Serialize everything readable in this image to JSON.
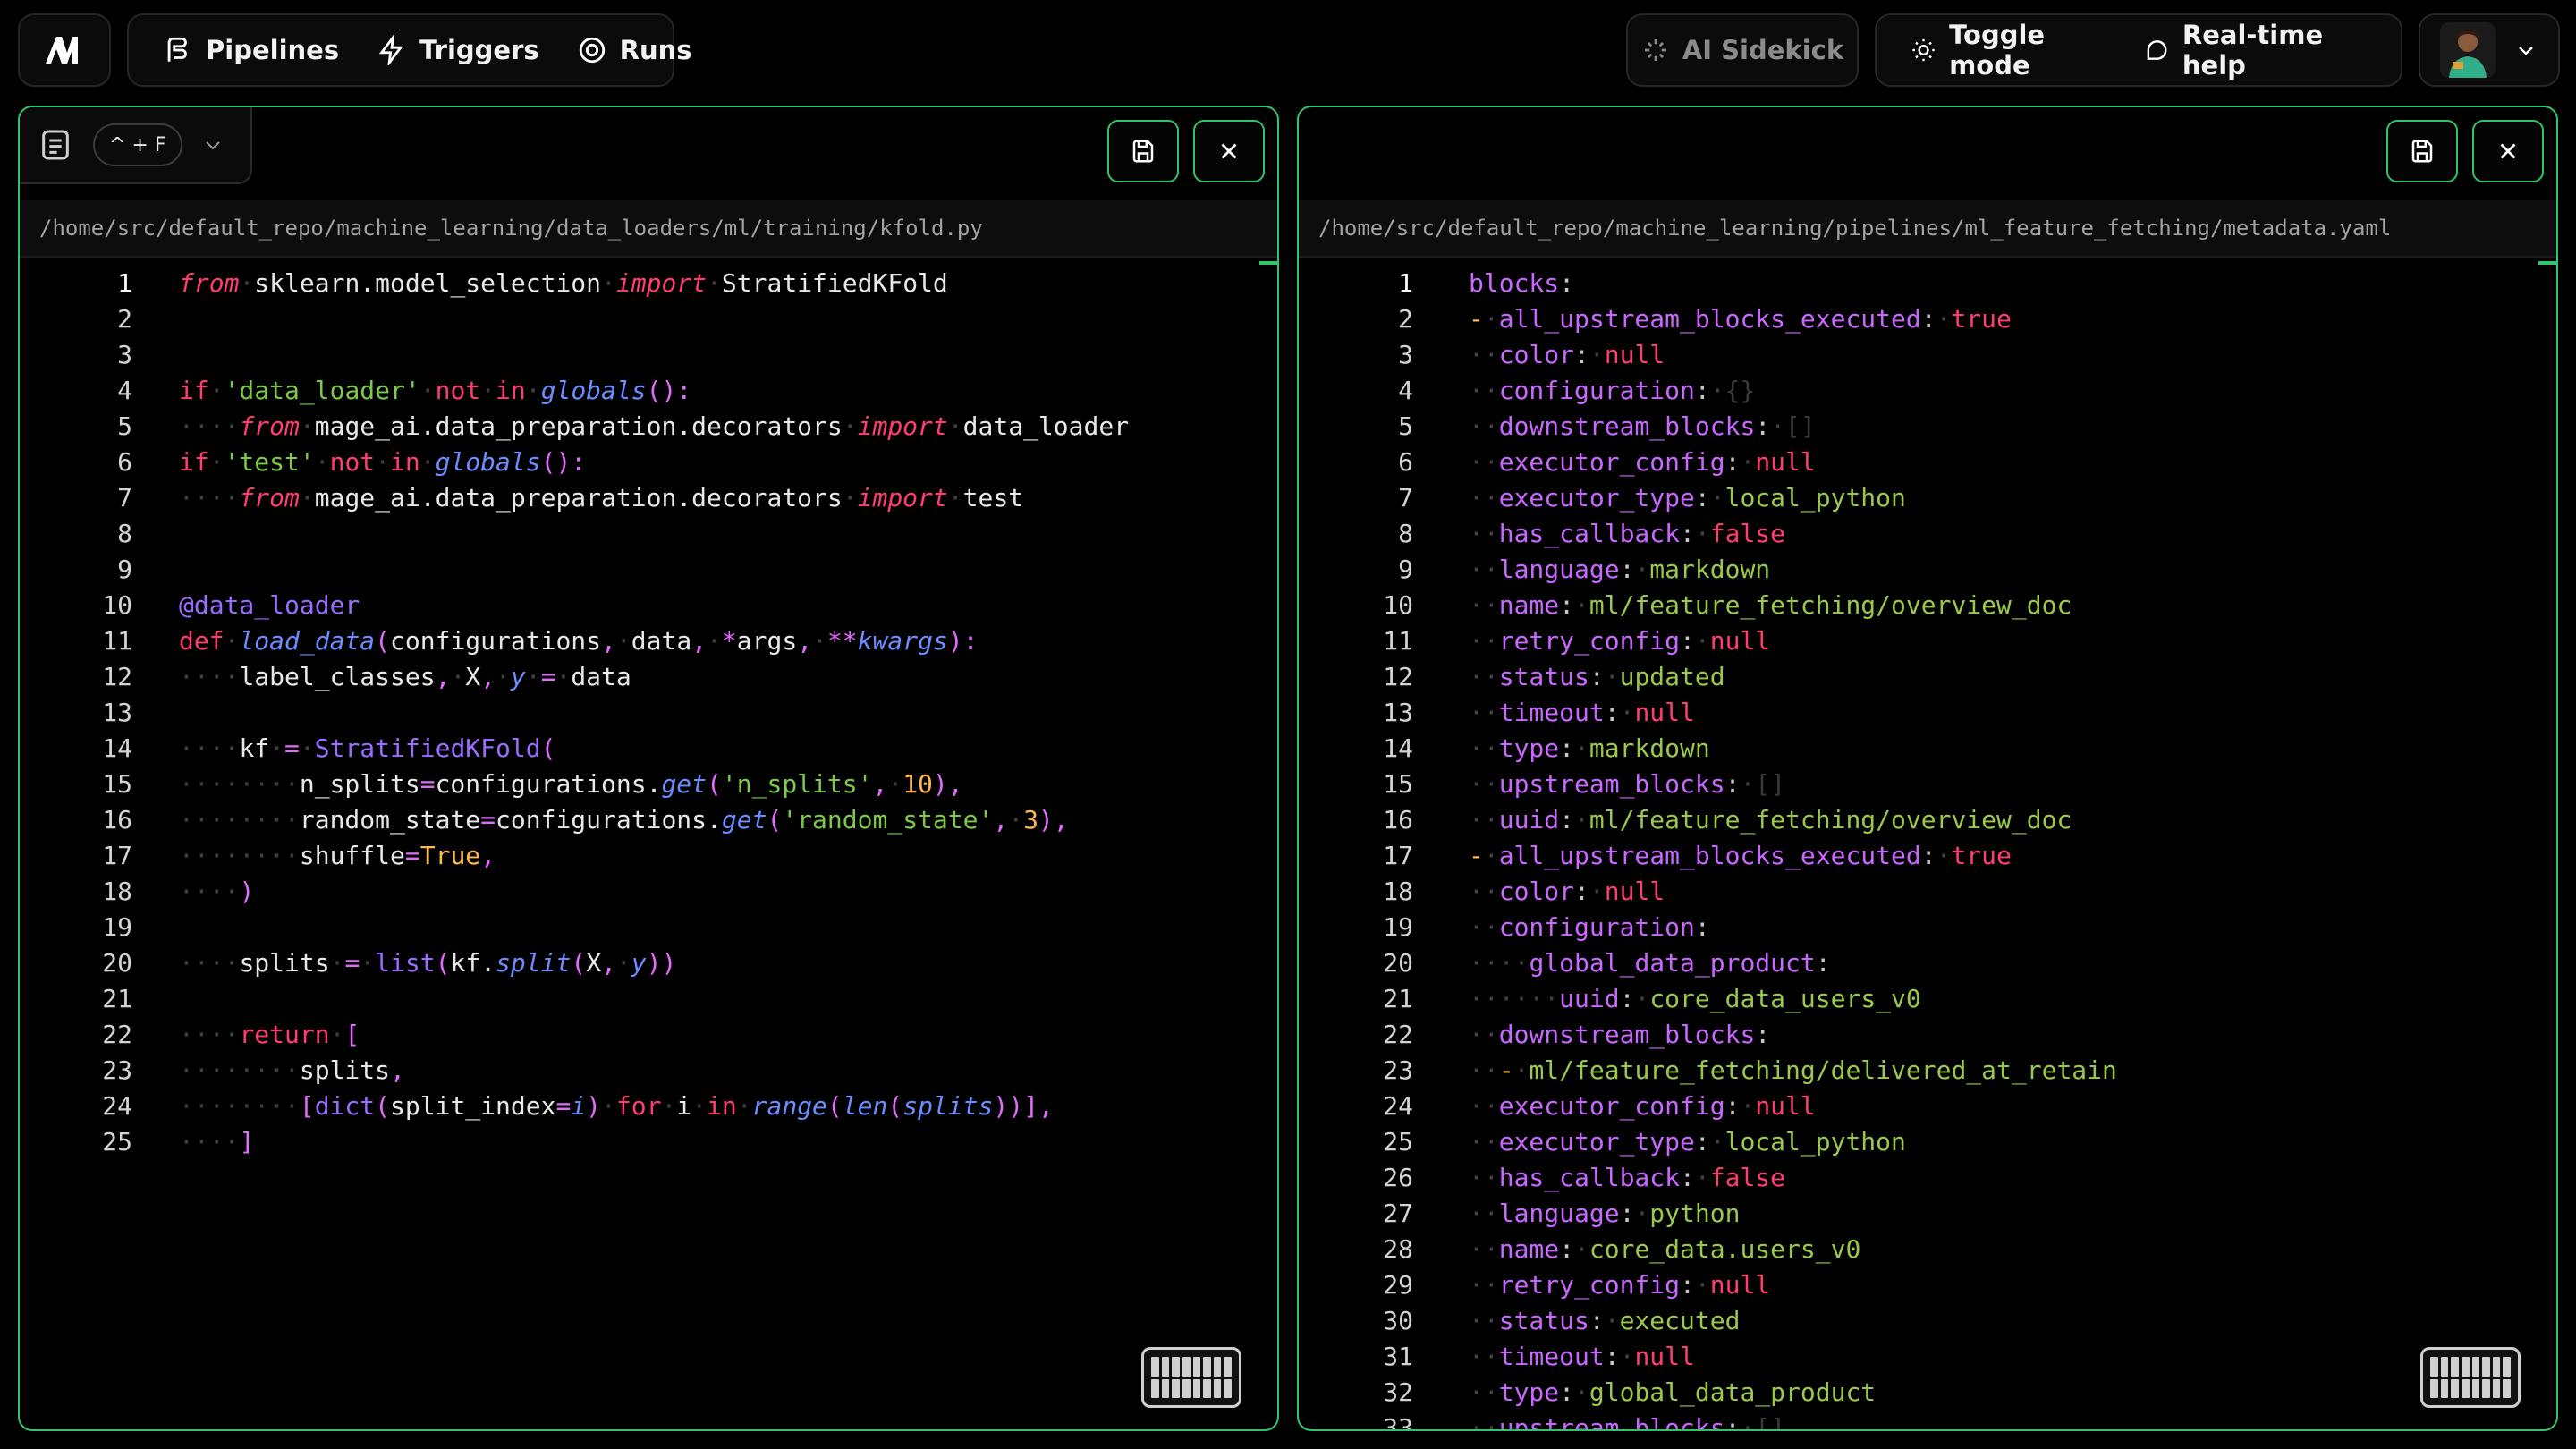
{
  "nav": {
    "pipelines": "Pipelines",
    "triggers": "Triggers",
    "runs": "Runs"
  },
  "actions": {
    "ai_sidekick": "AI Sidekick",
    "toggle_mode": "Toggle mode",
    "realtime_help": "Real-time help"
  },
  "left_panel": {
    "shortcut": "^ + F",
    "path": "/home/src/default_repo/machine_learning/data_loaders/ml/training/kfold.py"
  },
  "right_panel": {
    "path": "/home/src/default_repo/machine_learning/pipelines/ml_feature_fetching/metadata.yaml"
  },
  "colors": {
    "accent": "#30c46b",
    "keyword": "#ff3d6e",
    "function": "#6c8cff",
    "string": "#7cc84a",
    "number": "#ffb84d",
    "yaml_key": "#c968ff"
  },
  "left_code": [
    [
      [
        "kwi",
        "from"
      ],
      [
        "ws",
        "·"
      ],
      [
        "tx",
        "sklearn.model_selection"
      ],
      [
        "ws",
        "·"
      ],
      [
        "kwi",
        "import"
      ],
      [
        "ws",
        "·"
      ],
      [
        "tx",
        "StratifiedKFold"
      ]
    ],
    [],
    [],
    [
      [
        "kw",
        "if"
      ],
      [
        "ws",
        "·"
      ],
      [
        "str",
        "'data_loader'"
      ],
      [
        "ws",
        "·"
      ],
      [
        "kw",
        "not"
      ],
      [
        "ws",
        "·"
      ],
      [
        "kw",
        "in"
      ],
      [
        "ws",
        "·"
      ],
      [
        "fn",
        "globals"
      ],
      [
        "par",
        "():"
      ]
    ],
    [
      [
        "ws",
        "····"
      ],
      [
        "kwi",
        "from"
      ],
      [
        "ws",
        "·"
      ],
      [
        "tx",
        "mage_ai.data_preparation.decorators"
      ],
      [
        "ws",
        "·"
      ],
      [
        "kwi",
        "import"
      ],
      [
        "ws",
        "·"
      ],
      [
        "tx",
        "data_loader"
      ]
    ],
    [
      [
        "kw",
        "if"
      ],
      [
        "ws",
        "·"
      ],
      [
        "str",
        "'test'"
      ],
      [
        "ws",
        "·"
      ],
      [
        "kw",
        "not"
      ],
      [
        "ws",
        "·"
      ],
      [
        "kw",
        "in"
      ],
      [
        "ws",
        "·"
      ],
      [
        "fn",
        "globals"
      ],
      [
        "par",
        "():"
      ]
    ],
    [
      [
        "ws",
        "····"
      ],
      [
        "kwi",
        "from"
      ],
      [
        "ws",
        "·"
      ],
      [
        "tx",
        "mage_ai.data_preparation.decorators"
      ],
      [
        "ws",
        "·"
      ],
      [
        "kwi",
        "import"
      ],
      [
        "ws",
        "·"
      ],
      [
        "tx",
        "test"
      ]
    ],
    [],
    [],
    [
      [
        "dec",
        "@data_loader"
      ]
    ],
    [
      [
        "kw",
        "def"
      ],
      [
        "ws",
        "·"
      ],
      [
        "fn",
        "load_data"
      ],
      [
        "par",
        "("
      ],
      [
        "tx",
        "configurations"
      ],
      [
        "pun",
        ","
      ],
      [
        "ws",
        "·"
      ],
      [
        "tx",
        "data"
      ],
      [
        "pun",
        ","
      ],
      [
        "ws",
        "·"
      ],
      [
        "pun",
        "*"
      ],
      [
        "tx",
        "args"
      ],
      [
        "pun",
        ","
      ],
      [
        "ws",
        "·"
      ],
      [
        "pun",
        "**"
      ],
      [
        "fn",
        "kwargs"
      ],
      [
        "par",
        "):"
      ]
    ],
    [
      [
        "ws",
        "····"
      ],
      [
        "tx",
        "label_classes"
      ],
      [
        "pun",
        ","
      ],
      [
        "ws",
        "·"
      ],
      [
        "tx",
        "X"
      ],
      [
        "pun",
        ","
      ],
      [
        "ws",
        "·"
      ],
      [
        "fn",
        "y"
      ],
      [
        "ws",
        "·"
      ],
      [
        "pun",
        "="
      ],
      [
        "ws",
        "·"
      ],
      [
        "tx",
        "data"
      ]
    ],
    [],
    [
      [
        "ws",
        "····"
      ],
      [
        "tx",
        "kf"
      ],
      [
        "ws",
        "·"
      ],
      [
        "pun",
        "="
      ],
      [
        "ws",
        "·"
      ],
      [
        "cls",
        "StratifiedKFold"
      ],
      [
        "par",
        "("
      ]
    ],
    [
      [
        "ws",
        "········"
      ],
      [
        "tx",
        "n_splits"
      ],
      [
        "pun",
        "="
      ],
      [
        "tx",
        "configurations."
      ],
      [
        "fn",
        "get"
      ],
      [
        "par",
        "("
      ],
      [
        "str",
        "'n_splits'"
      ],
      [
        "pun",
        ","
      ],
      [
        "ws",
        "·"
      ],
      [
        "num",
        "10"
      ],
      [
        "par",
        "),"
      ]
    ],
    [
      [
        "ws",
        "········"
      ],
      [
        "tx",
        "random_state"
      ],
      [
        "pun",
        "="
      ],
      [
        "tx",
        "configurations."
      ],
      [
        "fn",
        "get"
      ],
      [
        "par",
        "("
      ],
      [
        "str",
        "'random_state'"
      ],
      [
        "pun",
        ","
      ],
      [
        "ws",
        "·"
      ],
      [
        "num",
        "3"
      ],
      [
        "par",
        "),"
      ]
    ],
    [
      [
        "ws",
        "········"
      ],
      [
        "tx",
        "shuffle"
      ],
      [
        "pun",
        "="
      ],
      [
        "bool",
        "True"
      ],
      [
        "pun",
        ","
      ]
    ],
    [
      [
        "ws",
        "····"
      ],
      [
        "par",
        ")"
      ]
    ],
    [],
    [
      [
        "ws",
        "····"
      ],
      [
        "tx",
        "splits"
      ],
      [
        "ws",
        "·"
      ],
      [
        "pun",
        "="
      ],
      [
        "ws",
        "·"
      ],
      [
        "cls",
        "list"
      ],
      [
        "par",
        "("
      ],
      [
        "tx",
        "kf."
      ],
      [
        "fn",
        "split"
      ],
      [
        "par",
        "("
      ],
      [
        "tx",
        "X"
      ],
      [
        "pun",
        ","
      ],
      [
        "ws",
        "·"
      ],
      [
        "fn",
        "y"
      ],
      [
        "par",
        "))"
      ]
    ],
    [],
    [
      [
        "ws",
        "····"
      ],
      [
        "kw",
        "return"
      ],
      [
        "ws",
        "·"
      ],
      [
        "par",
        "["
      ]
    ],
    [
      [
        "ws",
        "········"
      ],
      [
        "tx",
        "splits"
      ],
      [
        "pun",
        ","
      ]
    ],
    [
      [
        "ws",
        "········"
      ],
      [
        "par",
        "["
      ],
      [
        "cls",
        "dict"
      ],
      [
        "par",
        "("
      ],
      [
        "tx",
        "split_index"
      ],
      [
        "pun",
        "="
      ],
      [
        "fn",
        "i"
      ],
      [
        "par",
        ")"
      ],
      [
        "ws",
        "·"
      ],
      [
        "kw",
        "for"
      ],
      [
        "ws",
        "·"
      ],
      [
        "tx",
        "i"
      ],
      [
        "ws",
        "·"
      ],
      [
        "kw",
        "in"
      ],
      [
        "ws",
        "·"
      ],
      [
        "fn",
        "range"
      ],
      [
        "par",
        "("
      ],
      [
        "fn",
        "len"
      ],
      [
        "par",
        "("
      ],
      [
        "fn",
        "splits"
      ],
      [
        "par",
        "))],"
      ]
    ],
    [
      [
        "ws",
        "····"
      ],
      [
        "par",
        "]"
      ]
    ]
  ],
  "right_code": [
    [
      [
        "ykey",
        "blocks"
      ],
      [
        "yplain",
        ":"
      ]
    ],
    [
      [
        "ydash",
        "-"
      ],
      [
        "ws",
        "·"
      ],
      [
        "ykey",
        "all_upstream_blocks_executed"
      ],
      [
        "yplain",
        ":"
      ],
      [
        "ws",
        "·"
      ],
      [
        "ynull",
        "true"
      ]
    ],
    [
      [
        "ws",
        "··"
      ],
      [
        "ykey",
        "color"
      ],
      [
        "yplain",
        ":"
      ],
      [
        "ws",
        "·"
      ],
      [
        "ynull",
        "null"
      ]
    ],
    [
      [
        "ws",
        "··"
      ],
      [
        "ykey",
        "configuration"
      ],
      [
        "yplain",
        ":"
      ],
      [
        "ws",
        "·"
      ],
      [
        "ydim",
        "{}"
      ]
    ],
    [
      [
        "ws",
        "··"
      ],
      [
        "ykey",
        "downstream_blocks"
      ],
      [
        "yplain",
        ":"
      ],
      [
        "ws",
        "·"
      ],
      [
        "ydim",
        "[]"
      ]
    ],
    [
      [
        "ws",
        "··"
      ],
      [
        "ykey",
        "executor_config"
      ],
      [
        "yplain",
        ":"
      ],
      [
        "ws",
        "·"
      ],
      [
        "ynull",
        "null"
      ]
    ],
    [
      [
        "ws",
        "··"
      ],
      [
        "ykey",
        "executor_type"
      ],
      [
        "yplain",
        ":"
      ],
      [
        "ws",
        "·"
      ],
      [
        "yval",
        "local_python"
      ]
    ],
    [
      [
        "ws",
        "··"
      ],
      [
        "ykey",
        "has_callback"
      ],
      [
        "yplain",
        ":"
      ],
      [
        "ws",
        "·"
      ],
      [
        "ynull",
        "false"
      ]
    ],
    [
      [
        "ws",
        "··"
      ],
      [
        "ykey",
        "language"
      ],
      [
        "yplain",
        ":"
      ],
      [
        "ws",
        "·"
      ],
      [
        "yval",
        "markdown"
      ]
    ],
    [
      [
        "ws",
        "··"
      ],
      [
        "ykey",
        "name"
      ],
      [
        "yplain",
        ":"
      ],
      [
        "ws",
        "·"
      ],
      [
        "yval",
        "ml/feature_fetching/overview_doc"
      ]
    ],
    [
      [
        "ws",
        "··"
      ],
      [
        "ykey",
        "retry_config"
      ],
      [
        "yplain",
        ":"
      ],
      [
        "ws",
        "·"
      ],
      [
        "ynull",
        "null"
      ]
    ],
    [
      [
        "ws",
        "··"
      ],
      [
        "ykey",
        "status"
      ],
      [
        "yplain",
        ":"
      ],
      [
        "ws",
        "·"
      ],
      [
        "yval",
        "updated"
      ]
    ],
    [
      [
        "ws",
        "··"
      ],
      [
        "ykey",
        "timeout"
      ],
      [
        "yplain",
        ":"
      ],
      [
        "ws",
        "·"
      ],
      [
        "ynull",
        "null"
      ]
    ],
    [
      [
        "ws",
        "··"
      ],
      [
        "ykey",
        "type"
      ],
      [
        "yplain",
        ":"
      ],
      [
        "ws",
        "·"
      ],
      [
        "yval",
        "markdown"
      ]
    ],
    [
      [
        "ws",
        "··"
      ],
      [
        "ykey",
        "upstream_blocks"
      ],
      [
        "yplain",
        ":"
      ],
      [
        "ws",
        "·"
      ],
      [
        "ydim",
        "[]"
      ]
    ],
    [
      [
        "ws",
        "··"
      ],
      [
        "ykey",
        "uuid"
      ],
      [
        "yplain",
        ":"
      ],
      [
        "ws",
        "·"
      ],
      [
        "yval",
        "ml/feature_fetching/overview_doc"
      ]
    ],
    [
      [
        "ydash",
        "-"
      ],
      [
        "ws",
        "·"
      ],
      [
        "ykey",
        "all_upstream_blocks_executed"
      ],
      [
        "yplain",
        ":"
      ],
      [
        "ws",
        "·"
      ],
      [
        "ynull",
        "true"
      ]
    ],
    [
      [
        "ws",
        "··"
      ],
      [
        "ykey",
        "color"
      ],
      [
        "yplain",
        ":"
      ],
      [
        "ws",
        "·"
      ],
      [
        "ynull",
        "null"
      ]
    ],
    [
      [
        "ws",
        "··"
      ],
      [
        "ykey",
        "configuration"
      ],
      [
        "yplain",
        ":"
      ]
    ],
    [
      [
        "ws",
        "····"
      ],
      [
        "ykey",
        "global_data_product"
      ],
      [
        "yplain",
        ":"
      ]
    ],
    [
      [
        "ws",
        "······"
      ],
      [
        "ykey",
        "uuid"
      ],
      [
        "yplain",
        ":"
      ],
      [
        "ws",
        "·"
      ],
      [
        "yval",
        "core_data_users_v0"
      ]
    ],
    [
      [
        "ws",
        "··"
      ],
      [
        "ykey",
        "downstream_blocks"
      ],
      [
        "yplain",
        ":"
      ]
    ],
    [
      [
        "ws",
        "··"
      ],
      [
        "ydash",
        "-"
      ],
      [
        "ws",
        "·"
      ],
      [
        "yval",
        "ml/feature_fetching/delivered_at_retain"
      ]
    ],
    [
      [
        "ws",
        "··"
      ],
      [
        "ykey",
        "executor_config"
      ],
      [
        "yplain",
        ":"
      ],
      [
        "ws",
        "·"
      ],
      [
        "ynull",
        "null"
      ]
    ],
    [
      [
        "ws",
        "··"
      ],
      [
        "ykey",
        "executor_type"
      ],
      [
        "yplain",
        ":"
      ],
      [
        "ws",
        "·"
      ],
      [
        "yval",
        "local_python"
      ]
    ],
    [
      [
        "ws",
        "··"
      ],
      [
        "ykey",
        "has_callback"
      ],
      [
        "yplain",
        ":"
      ],
      [
        "ws",
        "·"
      ],
      [
        "ynull",
        "false"
      ]
    ],
    [
      [
        "ws",
        "··"
      ],
      [
        "ykey",
        "language"
      ],
      [
        "yplain",
        ":"
      ],
      [
        "ws",
        "·"
      ],
      [
        "yval",
        "python"
      ]
    ],
    [
      [
        "ws",
        "··"
      ],
      [
        "ykey",
        "name"
      ],
      [
        "yplain",
        ":"
      ],
      [
        "ws",
        "·"
      ],
      [
        "yval",
        "core_data.users_v0"
      ]
    ],
    [
      [
        "ws",
        "··"
      ],
      [
        "ykey",
        "retry_config"
      ],
      [
        "yplain",
        ":"
      ],
      [
        "ws",
        "·"
      ],
      [
        "ynull",
        "null"
      ]
    ],
    [
      [
        "ws",
        "··"
      ],
      [
        "ykey",
        "status"
      ],
      [
        "yplain",
        ":"
      ],
      [
        "ws",
        "·"
      ],
      [
        "yval",
        "executed"
      ]
    ],
    [
      [
        "ws",
        "··"
      ],
      [
        "ykey",
        "timeout"
      ],
      [
        "yplain",
        ":"
      ],
      [
        "ws",
        "·"
      ],
      [
        "ynull",
        "null"
      ]
    ],
    [
      [
        "ws",
        "··"
      ],
      [
        "ykey",
        "type"
      ],
      [
        "yplain",
        ":"
      ],
      [
        "ws",
        "·"
      ],
      [
        "yval",
        "global_data_product"
      ]
    ],
    [
      [
        "ws",
        "··"
      ],
      [
        "ykey",
        "upstream_blocks"
      ],
      [
        "yplain",
        ":"
      ],
      [
        "ws",
        "·"
      ],
      [
        "ydim",
        "[]"
      ]
    ]
  ]
}
